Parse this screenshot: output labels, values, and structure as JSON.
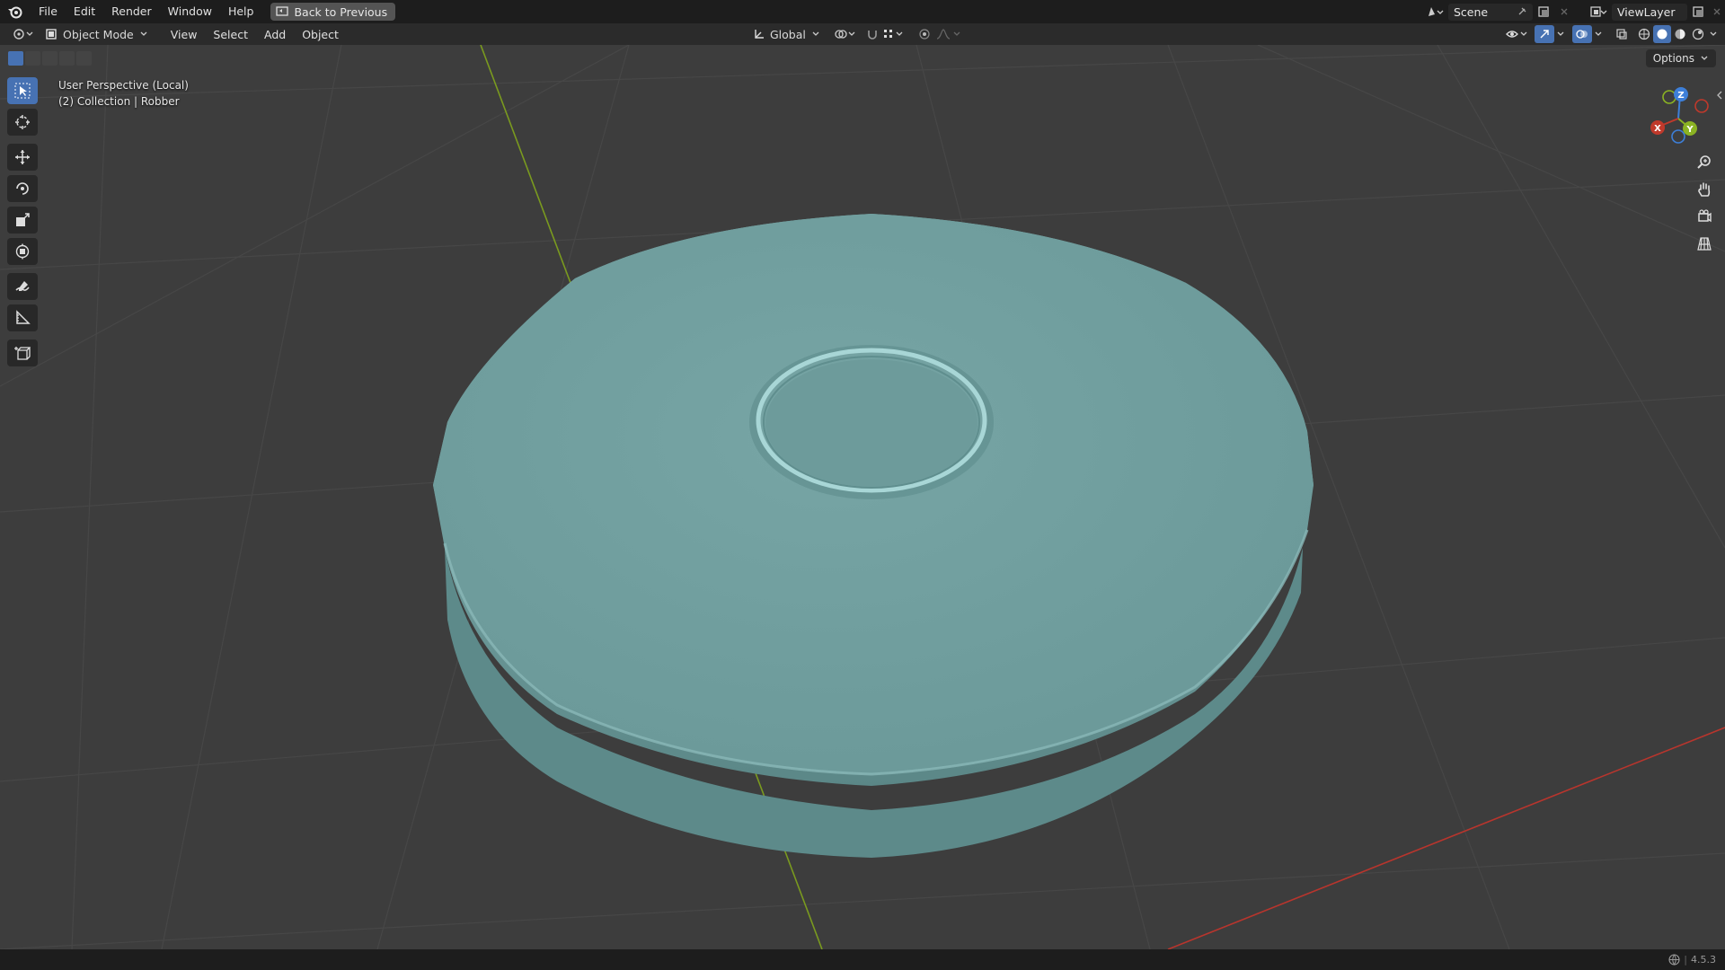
{
  "menubar": {
    "items": [
      "File",
      "Edit",
      "Render",
      "Window",
      "Help"
    ],
    "back_button": "Back to Previous",
    "scene": "Scene",
    "view_layer": "ViewLayer"
  },
  "header": {
    "mode": "Object Mode",
    "menus": [
      "View",
      "Select",
      "Add",
      "Object"
    ],
    "orientation": "Global",
    "options": "Options"
  },
  "viewport": {
    "perspective": "User Perspective (Local)",
    "collection": "(2) Collection | Robber",
    "gizmo": {
      "x": "X",
      "y": "Y",
      "z": "Z"
    }
  },
  "status": {
    "version": "4.5.3"
  },
  "colors": {
    "accent": "#4772b3",
    "object": "#6fa0a0",
    "x_axis": "#c0392b",
    "y_axis": "#8bb323",
    "z_axis": "#3d7fd9"
  }
}
